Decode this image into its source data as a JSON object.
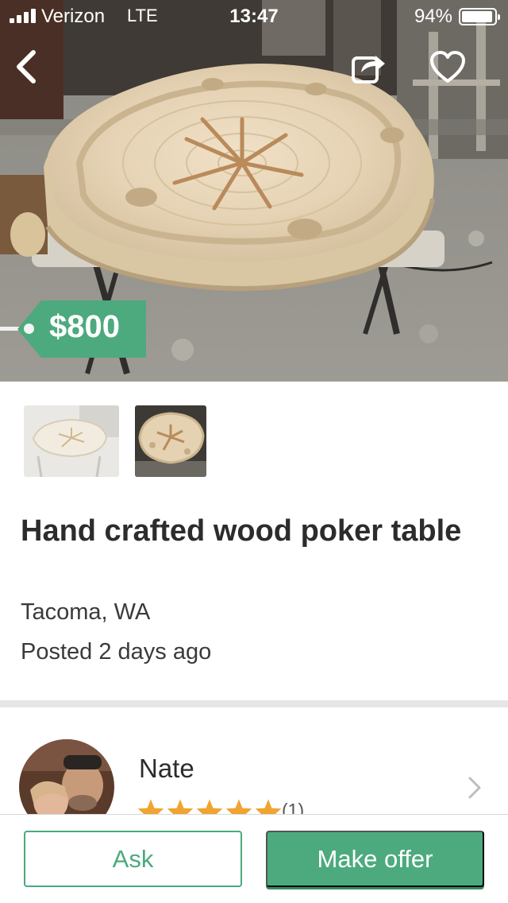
{
  "status_bar": {
    "carrier": "Verizon",
    "network": "LTE",
    "time": "13:47",
    "battery_percent": "94%",
    "battery_level": 0.94
  },
  "hero": {
    "image": "wood-poker-table-photo",
    "price": "$800",
    "icons": {
      "back": "chevron-left-icon",
      "share": "share-icon",
      "favorite": "heart-icon"
    }
  },
  "thumbnails": [
    {
      "image": "poker-table-thumbnail-1"
    },
    {
      "image": "poker-table-thumbnail-2"
    }
  ],
  "listing": {
    "title": "Hand crafted wood poker table",
    "location": "Tacoma, WA",
    "posted": "Posted 2 days ago"
  },
  "seller": {
    "name": "Nate",
    "rating": 5,
    "rating_max": 5,
    "review_count": "(1)"
  },
  "actions": {
    "ask_label": "Ask",
    "offer_label": "Make offer"
  },
  "colors": {
    "accent": "#4caa7e",
    "star": "#f0a431",
    "text": "#2c2c2c"
  }
}
